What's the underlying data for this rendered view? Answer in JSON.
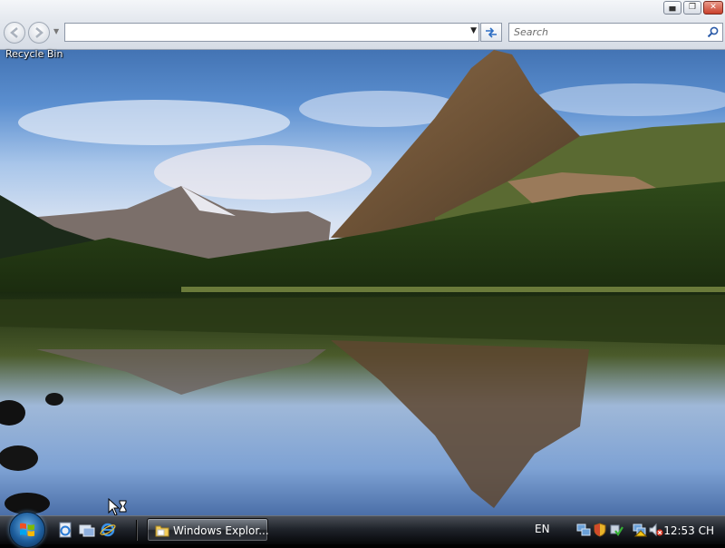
{
  "window": {
    "address_value": "",
    "search_placeholder": "Search",
    "buttons": {
      "back": "back",
      "forward": "forward",
      "minimize": "minimize",
      "maximize": "maximize",
      "close": "close"
    }
  },
  "desktop": {
    "icons": [
      {
        "label": "Recycle Bin",
        "icon": "recycle-bin-icon"
      }
    ]
  },
  "taskbar": {
    "quick_launch": [
      "ie-page-icon",
      "show-desktop-icon",
      "internet-explorer-icon"
    ],
    "tasks": [
      {
        "label": "Windows Explor...",
        "icon": "folder-icon"
      }
    ],
    "language": "EN",
    "tray_icons": [
      "network-icon",
      "security-shield-icon",
      "windows-defender-icon",
      "network-error-icon",
      "volume-muted-icon"
    ],
    "clock": "12:53 CH"
  },
  "colors": {
    "taskbar": "#1b1e23",
    "window_frame": "#dde2ea",
    "sky": "#4f86c6"
  }
}
